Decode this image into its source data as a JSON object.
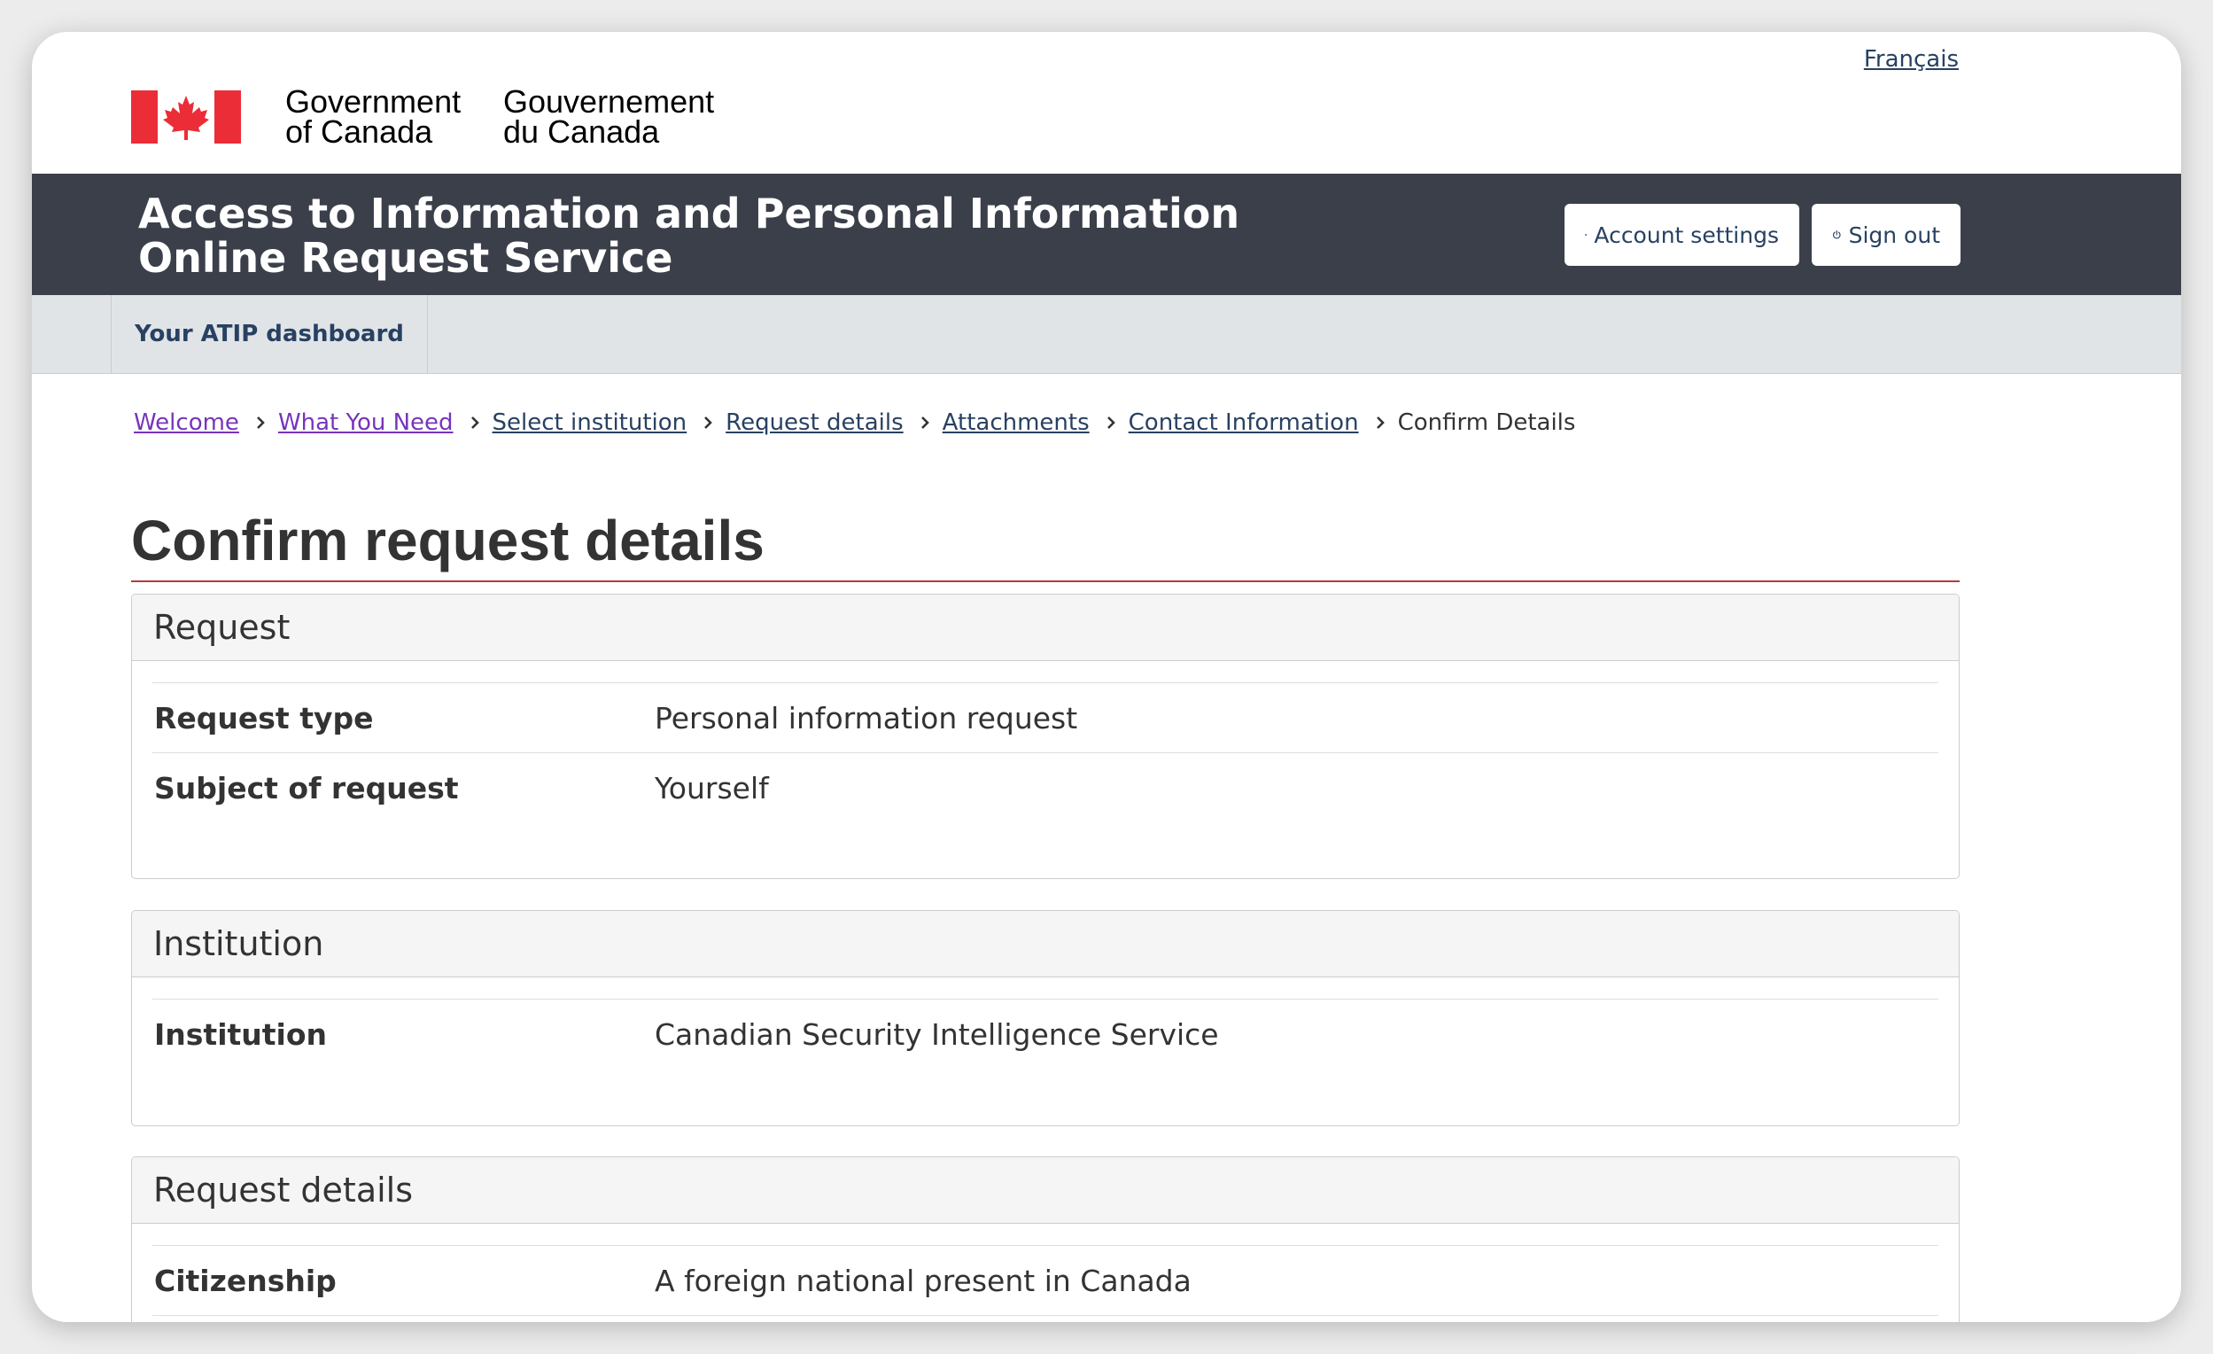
{
  "header": {
    "language_toggle": "Français",
    "signature_en_line1": "Government",
    "signature_en_line2": "of Canada",
    "signature_fr_line1": "Gouvernement",
    "signature_fr_line2": "du Canada"
  },
  "app_bar": {
    "title_line1": "Access to Information and Personal Information",
    "title_line2": "Online Request Service",
    "account_settings": "Account settings",
    "sign_out": "Sign out",
    "color": "#3a3f4a"
  },
  "nav": {
    "dashboard": "Your ATIP dashboard"
  },
  "breadcrumb": [
    {
      "label": "Welcome"
    },
    {
      "label": "What You Need"
    },
    {
      "label": "Select institution"
    },
    {
      "label": "Request details"
    },
    {
      "label": "Attachments"
    },
    {
      "label": "Contact Information"
    },
    {
      "label": "Confirm Details"
    }
  ],
  "main": {
    "title": "Confirm request details",
    "sections": [
      {
        "heading": "Request",
        "rows": [
          {
            "label": "Request type",
            "value": "Personal information request"
          },
          {
            "label": "Subject of request",
            "value": "Yourself"
          }
        ]
      },
      {
        "heading": "Institution",
        "rows": [
          {
            "label": "Institution",
            "value": "Canadian Security Intelligence Service"
          }
        ]
      },
      {
        "heading": "Request details",
        "rows": [
          {
            "label": "Citizenship",
            "value": "A foreign national present in Canada"
          }
        ]
      }
    ]
  },
  "colors": {
    "flag_red": "#eb2d37",
    "link": "#284162",
    "visited_link": "#7834bc",
    "title_rule": "#af3c43"
  }
}
